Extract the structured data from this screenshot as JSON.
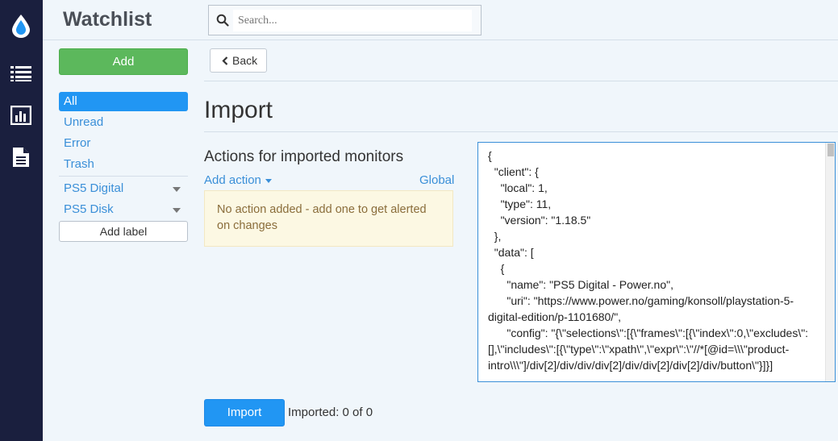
{
  "rail": {
    "icons": [
      "drop-logo-icon",
      "list-icon",
      "chart-icon",
      "document-icon"
    ]
  },
  "header": {
    "title": "Watchlist",
    "search_placeholder": "Search..."
  },
  "sidebar": {
    "add_label": "Add",
    "items": [
      {
        "label": "All",
        "active": true
      },
      {
        "label": "Unread"
      },
      {
        "label": "Error"
      },
      {
        "label": "Trash"
      }
    ],
    "labels": [
      {
        "label": "PS5 Digital"
      },
      {
        "label": "PS5 Disk"
      }
    ],
    "add_label_button": "Add label"
  },
  "main": {
    "back_label": "Back",
    "title": "Import",
    "section_title": "Actions for imported monitors",
    "add_action_label": "Add action",
    "global_label": "Global",
    "alert_text": "No action added - add one to get alerted on changes",
    "json_text": "{\n  \"client\": {\n    \"local\": 1,\n    \"type\": 11,\n    \"version\": \"1.18.5\"\n  },\n  \"data\": [\n    {\n      \"name\": \"PS5 Digital - Power.no\",\n      \"uri\": \"https://www.power.no/gaming/konsoll/playstation-5-digital-edition/p-1101680/\",\n      \"config\": \"{\\\"selections\\\":[{\\\"frames\\\":[{\\\"index\\\":0,\\\"excludes\\\":[],\\\"includes\\\":[{\\\"type\\\":\\\"xpath\\\",\\\"expr\\\":\\\"//*[@id=\\\\\\\"product-intro\\\\\\\"]/div[2]/div/div/div[2]/div/div[2]/div[2]/div/button\\\"}]}]",
    "import_label": "Import",
    "status_text": "Imported: 0 of 0"
  },
  "colors": {
    "rail": "#1a1f3e",
    "accent": "#2196f3",
    "add_green": "#5cb85c",
    "link": "#3a8fd8",
    "alert_bg": "#fcf8e3"
  }
}
